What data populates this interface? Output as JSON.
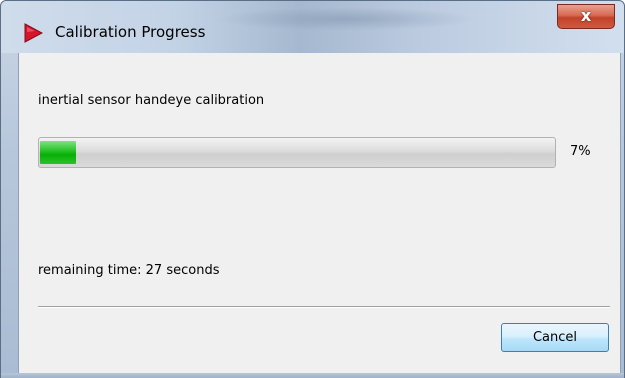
{
  "window": {
    "title": "Calibration Progress",
    "app_icon": "red-play-arrow-icon",
    "close_glyph": "x"
  },
  "task": {
    "label": "inertial sensor handeye calibration"
  },
  "progress": {
    "percent": 7,
    "percent_text": "7%",
    "fill_color": "#06b006"
  },
  "status": {
    "remaining_text": "remaining time: 27 seconds"
  },
  "buttons": {
    "cancel_label": "Cancel"
  }
}
